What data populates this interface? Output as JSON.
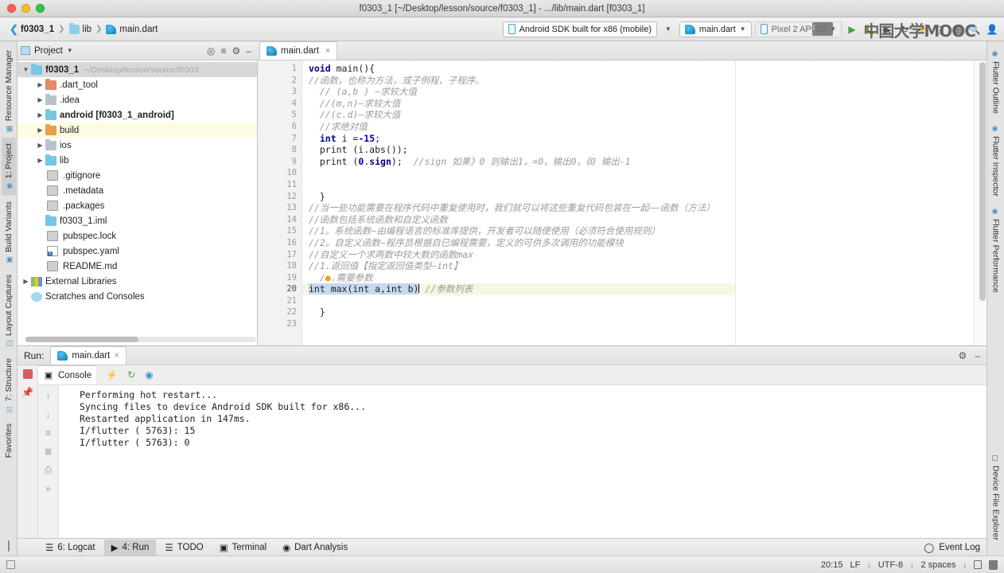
{
  "window": {
    "title": "f0303_1 [~/Desktop/lesson/source/f0303_1] - .../lib/main.dart [f0303_1]"
  },
  "breadcrumb": {
    "items": [
      {
        "label": "f0303_1",
        "icon": "chevron-left-icon"
      },
      {
        "label": "lib",
        "icon": "folder-icon"
      },
      {
        "label": "main.dart",
        "icon": "dart-file-icon"
      }
    ]
  },
  "toolbar": {
    "device_combo": "Android SDK built for x86 (mobile)",
    "run_config_combo": "main.dart",
    "emulator_combo": "Pixel 2 API 29",
    "watermark": "中国大学MOOC"
  },
  "project_panel": {
    "title": "Project",
    "header_icons": [
      "target-icon",
      "collapse-all-icon",
      "gear-icon",
      "minimize-icon"
    ],
    "tree": [
      {
        "label": "f0303_1",
        "path": "~/Desktop/lesson/source/f0303",
        "type": "folder-root",
        "arrow": "down",
        "bold": true,
        "state": "selected",
        "indent": 0
      },
      {
        "label": ".dart_tool",
        "type": "folder-red",
        "arrow": "right",
        "indent": 1
      },
      {
        "label": ".idea",
        "type": "folder-gray",
        "arrow": "right",
        "indent": 1
      },
      {
        "label": "android [f0303_1_android]",
        "type": "folder-blue",
        "arrow": "right",
        "indent": 1
      },
      {
        "label": "build",
        "type": "folder-orange",
        "arrow": "right",
        "indent": 1,
        "state": "highlight"
      },
      {
        "label": "ios",
        "type": "folder-gray",
        "arrow": "right",
        "indent": 1
      },
      {
        "label": "lib",
        "type": "folder-cyan",
        "arrow": "right",
        "indent": 1
      },
      {
        "label": ".gitignore",
        "type": "file",
        "indent": 2
      },
      {
        "label": ".metadata",
        "type": "file",
        "indent": 2
      },
      {
        "label": ".packages",
        "type": "file",
        "indent": 2
      },
      {
        "label": "f0303_1.iml",
        "type": "folder-blue",
        "indent": 2
      },
      {
        "label": "pubspec.lock",
        "type": "file",
        "indent": 2
      },
      {
        "label": "pubspec.yaml",
        "type": "yaml",
        "indent": 2
      },
      {
        "label": "README.md",
        "type": "file",
        "indent": 2
      },
      {
        "label": "External Libraries",
        "type": "lib",
        "arrow": "right",
        "indent": 0
      },
      {
        "label": "Scratches and Consoles",
        "type": "scratch",
        "indent": 0
      }
    ]
  },
  "editor": {
    "tab": {
      "label": "main.dart",
      "close": "×"
    },
    "lines": [
      {
        "n": 1,
        "text": "void main(){"
      },
      {
        "n": 2,
        "text": "//函数，也称为方法，或子例程、子程序。"
      },
      {
        "n": 3,
        "text": "  // (a,b ) —求较大值"
      },
      {
        "n": 4,
        "text": "  //(m,n)—求较大值"
      },
      {
        "n": 5,
        "text": "  //(c.d)—求较大值"
      },
      {
        "n": 6,
        "text": "  //求绝对值"
      },
      {
        "n": 7,
        "text": "  int i =-15;"
      },
      {
        "n": 8,
        "text": "  print (i.abs());"
      },
      {
        "n": 9,
        "text": "  print (0.sign);  //sign 如果》0 则输出1，=0，输出0，《0 输出-1"
      },
      {
        "n": 10,
        "text": ""
      },
      {
        "n": 11,
        "text": ""
      },
      {
        "n": 12,
        "text": "}"
      },
      {
        "n": 13,
        "text": "//当一些功能需要在程序代码中重复使用时，我们就可以将这些重复代码包装在一起——函数（方法）"
      },
      {
        "n": 14,
        "text": "//函数包括系统函数和自定义函数"
      },
      {
        "n": 15,
        "text": "//1。系统函数—由编程语言的标准库提供，开发者可以随便使用（必须符合使用规则）"
      },
      {
        "n": 16,
        "text": "//2。自定义函数—程序员根据自已编程需要，定义的可供多次调用的功能模块"
      },
      {
        "n": 17,
        "text": "//自定义一个求两数中较大数的函数max"
      },
      {
        "n": 18,
        "text": "//1.返回值【指定返回值类型—int】"
      },
      {
        "n": 19,
        "text": "/2.需要参数"
      },
      {
        "n": 20,
        "text": "int max(int a,int b)  //参数列表"
      },
      {
        "n": 21,
        "text": ""
      },
      {
        "n": 22,
        "text": "}"
      },
      {
        "n": 23,
        "text": ""
      }
    ],
    "current_line": 20
  },
  "run_panel": {
    "label": "Run:",
    "tab": "main.dart",
    "tab_close": "×",
    "console_tab": "Console",
    "console_tab_icons": [
      "rerun-icon",
      "restart-icon",
      "flutter-icon"
    ],
    "header_icons": [
      "gear-icon",
      "minimize-icon"
    ],
    "side_icons": [
      "stop-icon",
      "pin-icon"
    ],
    "tool_icons": [
      "scroll-up-icon",
      "scroll-down-icon",
      "soft-wrap-icon",
      "filter-icon",
      "print-icon",
      "expand-icon"
    ],
    "output": [
      "Performing hot restart...",
      "Syncing files to device Android SDK built for x86...",
      "Restarted application in 147ms.",
      "I/flutter ( 5763): 15",
      "I/flutter ( 5763): 0"
    ]
  },
  "tool_windows": {
    "items": [
      {
        "label": "6: Logcat",
        "icon": "logcat-icon",
        "active": false
      },
      {
        "label": "4: Run",
        "icon": "run-icon",
        "active": true
      },
      {
        "label": "TODO",
        "icon": "todo-icon",
        "active": false
      },
      {
        "label": "Terminal",
        "icon": "terminal-icon",
        "active": false
      },
      {
        "label": "Dart Analysis",
        "icon": "dart-icon",
        "active": false
      }
    ],
    "event_log": "Event Log"
  },
  "left_rail": {
    "items": [
      {
        "label": "Resource Manager",
        "icon": "resource-icon",
        "active": false
      },
      {
        "label": "1: Project",
        "icon": "project-icon",
        "active": true
      },
      {
        "label": "Build Variants",
        "icon": "build-icon",
        "active": false
      },
      {
        "label": "Layout Captures",
        "icon": "layout-icon",
        "active": false
      },
      {
        "label": "7: Structure",
        "icon": "structure-icon",
        "active": false
      },
      {
        "label": "Favorites",
        "icon": "favorites-icon",
        "active": false
      }
    ]
  },
  "right_rail": {
    "items": [
      {
        "label": "Flutter Outline",
        "icon": "flutter-icon",
        "active": false
      },
      {
        "label": "Flutter Inspector",
        "icon": "flutter-icon",
        "active": false
      },
      {
        "label": "Flutter Performance",
        "icon": "flutter-icon",
        "active": false
      },
      {
        "label": "Device File Explorer",
        "icon": "device-icon",
        "active": false
      }
    ]
  },
  "status_bar": {
    "caret_position": "20:15",
    "line_separator": "LF",
    "encoding": "UTF-8",
    "indent": "2 spaces",
    "icons": [
      "lock-icon",
      "trash-icon"
    ]
  },
  "colors": {
    "accent_blue": "#3d95c9",
    "keyword": "#000080",
    "comment": "#9b9b9b",
    "number": "#0000c0",
    "highlight_line": "#f6f6e2",
    "stop_red": "#d45a68",
    "run_green": "#3aa53a"
  }
}
